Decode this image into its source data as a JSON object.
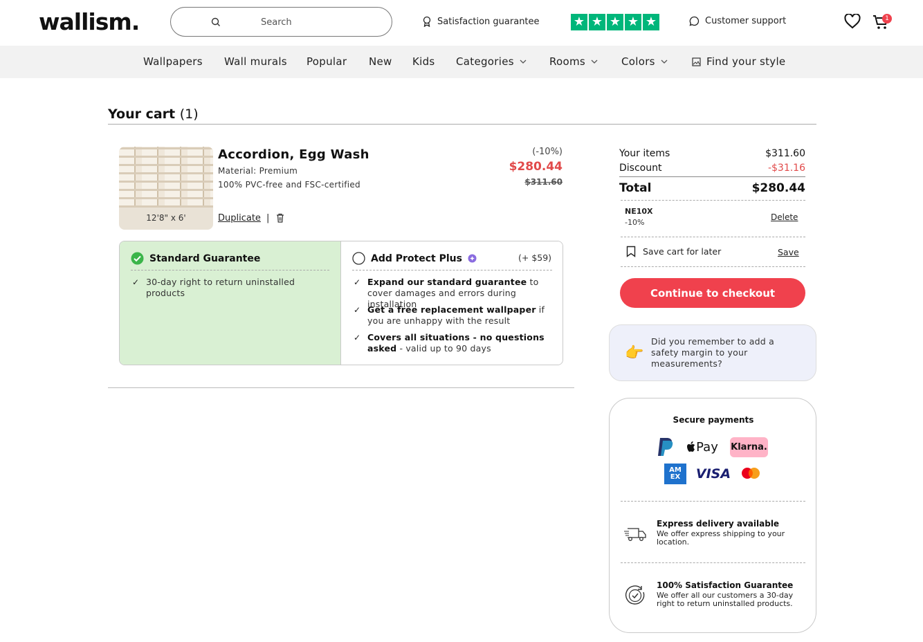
{
  "header": {
    "logo": "wallism.",
    "search_placeholder": "Search",
    "satisfaction": "Satisfaction guarantee",
    "trustpilot_stars": 5,
    "support": "Customer support",
    "cart_count": "1"
  },
  "nav": {
    "items": [
      {
        "label": "Wallpapers"
      },
      {
        "label": "Wall murals"
      },
      {
        "label": "Popular"
      },
      {
        "label": "New"
      },
      {
        "label": "Kids"
      },
      {
        "label": "Categories"
      },
      {
        "label": "Rooms"
      },
      {
        "label": "Colors"
      },
      {
        "label": "Find your style"
      }
    ]
  },
  "cart": {
    "title": "Your cart",
    "count": "(1)",
    "item": {
      "name": "Accordion, Egg Wash",
      "material": "Material: Premium",
      "cert": "100% PVC-free and FSC-certified",
      "dimensions": "12'8\" x 6'",
      "duplicate": "Duplicate",
      "separator": "|",
      "discount_pct": "(-10%)",
      "price": "$280.44",
      "old_price": "$311.60"
    },
    "guarantee": {
      "standard": {
        "title": "Standard Guarantee",
        "items": [
          "30-day right to return uninstalled products"
        ]
      },
      "protect": {
        "title": "Add Protect Plus",
        "price": "(+ $59)",
        "items": [
          {
            "bold": "Expand our standard guarantee",
            "rest": " to cover damages and errors during installation"
          },
          {
            "bold": "Get a free replacement wallpaper",
            "rest": " if you are unhappy with the result"
          },
          {
            "bold": "Covers all situations - no questions asked",
            "rest": " - valid up to 90 days"
          }
        ]
      }
    }
  },
  "summary": {
    "items_label": "Your items",
    "items_value": "$311.60",
    "discount_label": "Discount",
    "discount_value": "-$31.16",
    "total_label": "Total",
    "total_value": "$280.44",
    "coupon_code": "NE10X",
    "coupon_pct": "-10%",
    "coupon_delete": "Delete",
    "save_cart": "Save cart for later",
    "save_link": "Save",
    "checkout": "Continue to checkout",
    "tip": "Did you remember to add a safety margin to your measurements?"
  },
  "payments": {
    "title": "Secure payments",
    "logos": {
      "applepay": "Pay",
      "klarna": "Klarna.",
      "amex": "AM EX",
      "visa": "VISA"
    },
    "express_title": "Express delivery available",
    "express_text": "We offer express shipping to your location.",
    "guarantee_title": "100% Satisfaction Guarantee",
    "guarantee_text": "We offer all our customers a 30-day right to return uninstalled products."
  },
  "colors": {
    "accent": "#f0414d",
    "price_red": "#e14a4a",
    "trustpilot": "#00b67a",
    "guarantee_bg": "#d9f0d3",
    "tip_bg": "#eef0fa"
  }
}
